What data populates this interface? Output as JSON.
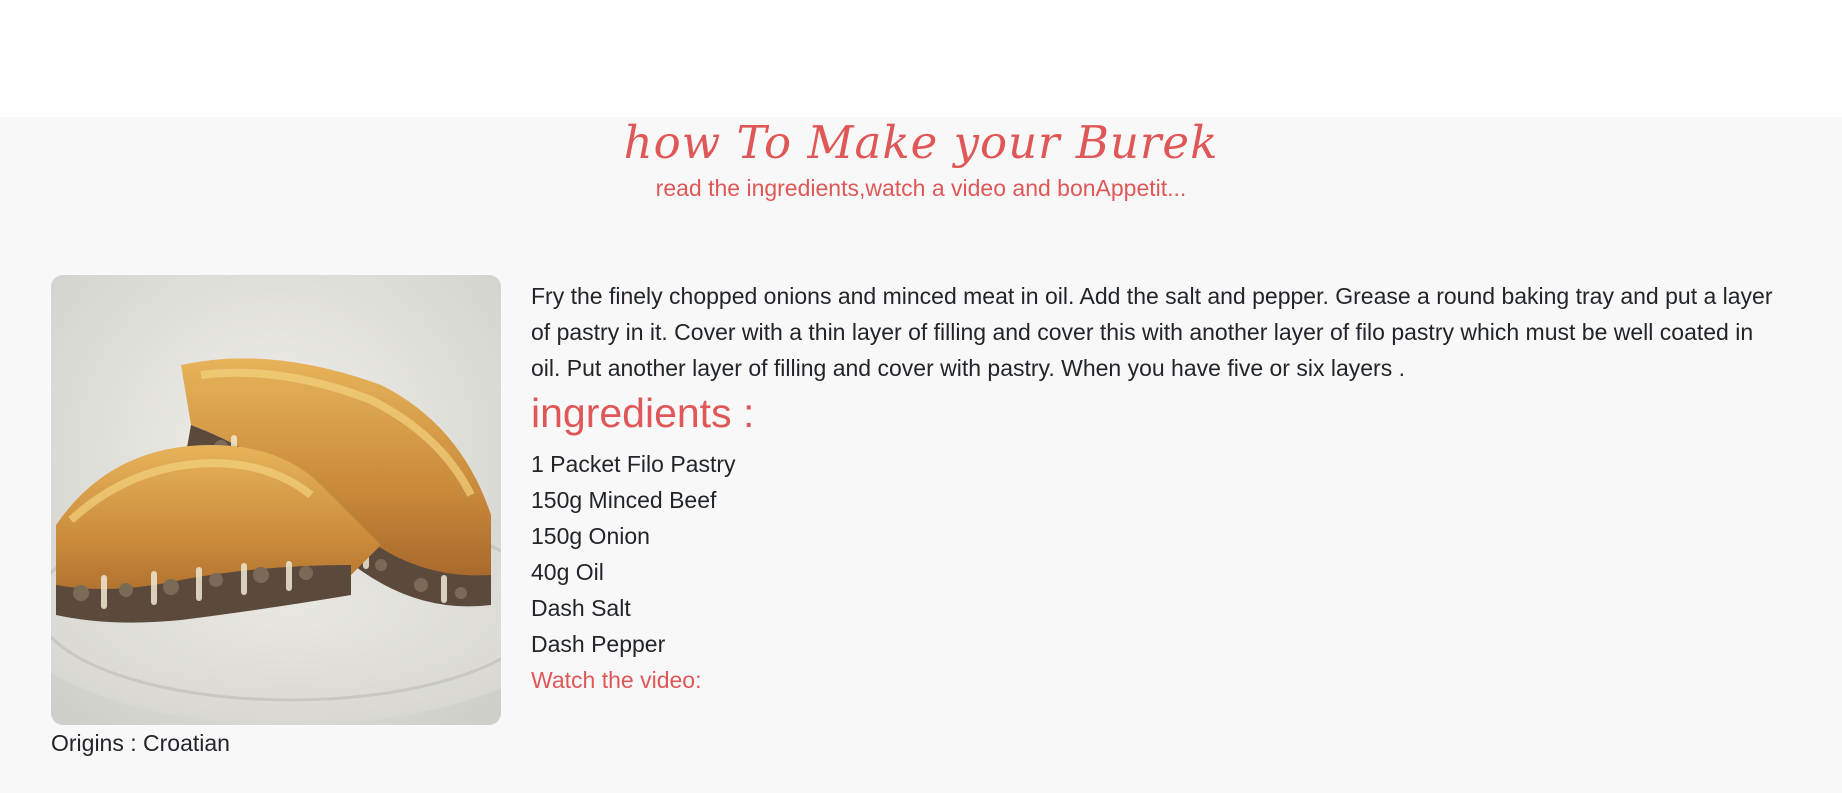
{
  "header": {
    "title": "how To Make your Burek",
    "subtitle": "read the ingredients,watch a video and bonAppetit..."
  },
  "recipe": {
    "image_alt": "Burek",
    "origin": "Origins : Croatian",
    "description": "Fry the finely chopped onions and minced meat in oil. Add the salt and pepper. Grease a round baking tray and put a layer of pastry in it. Cover with a thin layer of filling and cover this with another layer of filo pastry which must be well coated in oil. Put another layer of filling and cover with pastry. When you have five or six layers .",
    "ingredients_heading": "ingredients :",
    "ingredients": [
      "1 Packet Filo Pastry",
      "150g Minced Beef",
      "150g Onion",
      "40g Oil",
      "Dash Salt",
      "Dash Pepper"
    ],
    "video_link": "Watch the video:"
  },
  "colors": {
    "accent": "#e05757",
    "background": "#f8f8f8",
    "text": "#212529"
  }
}
